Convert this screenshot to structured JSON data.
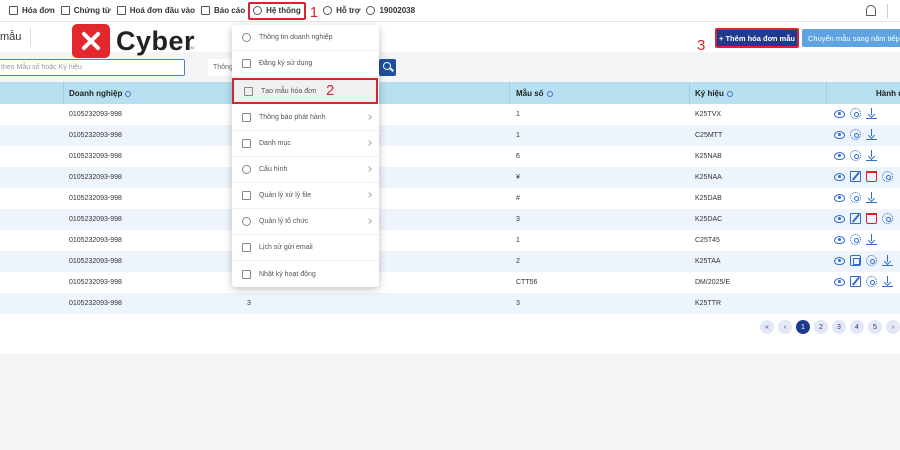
{
  "topnav": {
    "items": [
      {
        "label": "Hóa đơn"
      },
      {
        "label": "Chứng từ"
      },
      {
        "label": "Hoá đơn đầu vào"
      },
      {
        "label": "Báo cáo"
      },
      {
        "label": "Hệ thống"
      },
      {
        "label": "Hỗ trợ"
      }
    ],
    "hotline": "19002038"
  },
  "subbar": {
    "crumb": "mẫu",
    "logo_text": "Cyber",
    "logo_tm": "TM",
    "add_button": "+ Thêm hóa đơn mẫu",
    "convert_button": "Chuyển mẫu sang năm tiếp"
  },
  "steps": {
    "s1": "1",
    "s2": "2",
    "s3": "3"
  },
  "filters": {
    "search_placeholder": "theo Mẫu số hoặc Ký hiệu",
    "select_value": "Thông"
  },
  "table": {
    "headers": {
      "company": "Doanh nghiệp",
      "form": "Mẫu số",
      "symbol": "Ký hiệu",
      "actions": "Hành đ"
    },
    "rows": [
      {
        "company": "0105232093-998",
        "mid": "",
        "form": "1",
        "symbol": "K25TVX",
        "acts": [
          "eye",
          "gear",
          "dl"
        ]
      },
      {
        "company": "0105232093-998",
        "mid": "",
        "form": "1",
        "symbol": "C25MTT",
        "acts": [
          "eye",
          "gear",
          "dl"
        ]
      },
      {
        "company": "0105232093-998",
        "mid": "",
        "form": "6",
        "symbol": "K25NAB",
        "acts": [
          "eye",
          "gear",
          "dl"
        ]
      },
      {
        "company": "0105232093-998",
        "mid": "",
        "form": "¥",
        "symbol": "K25NAA",
        "acts": [
          "eye",
          "edit",
          "del",
          "gear"
        ]
      },
      {
        "company": "0105232093-998",
        "mid": "",
        "form": "#",
        "symbol": "K25DAB",
        "acts": [
          "eye",
          "gear",
          "dl"
        ]
      },
      {
        "company": "0105232093-998",
        "mid": "",
        "form": "3",
        "symbol": "K25DAC",
        "acts": [
          "eye",
          "edit",
          "del",
          "gear"
        ]
      },
      {
        "company": "0105232093-998",
        "mid": "",
        "form": "1",
        "symbol": "C25T45",
        "acts": [
          "eye",
          "gear",
          "dl"
        ]
      },
      {
        "company": "0105232093-998",
        "mid": "",
        "form": "2",
        "symbol": "K25TAA",
        "acts": [
          "eye",
          "copy",
          "gear",
          "dl"
        ]
      },
      {
        "company": "0105232093-998",
        "mid": "",
        "form": "CTT56",
        "symbol": "DM/2025/E",
        "acts": [
          "eye",
          "edit",
          "gear",
          "dl"
        ]
      },
      {
        "company": "0105232093-998",
        "mid": "3",
        "form": "3",
        "symbol": "K25TTR",
        "acts": []
      }
    ]
  },
  "pager": {
    "first": "«",
    "prev": "‹",
    "pages": [
      "1",
      "2",
      "3",
      "4",
      "5"
    ],
    "next": "›"
  },
  "dropdown": {
    "items": [
      {
        "label": "Thông tin doanh nghiệp",
        "arrow": false
      },
      {
        "label": "Đăng ký sử dụng",
        "arrow": false
      },
      {
        "label": "Tạo mẫu hóa đơn",
        "arrow": false
      },
      {
        "label": "Thông báo phát hành",
        "arrow": true
      },
      {
        "label": "Danh mục",
        "arrow": true
      },
      {
        "label": "Cấu hình",
        "arrow": true
      },
      {
        "label": "Quản lý xử lý file",
        "arrow": true
      },
      {
        "label": "Quản lý tổ chức",
        "arrow": true
      },
      {
        "label": "Lịch sử gửi email",
        "arrow": false
      },
      {
        "label": "Nhật ký hoạt động",
        "arrow": false
      }
    ]
  }
}
